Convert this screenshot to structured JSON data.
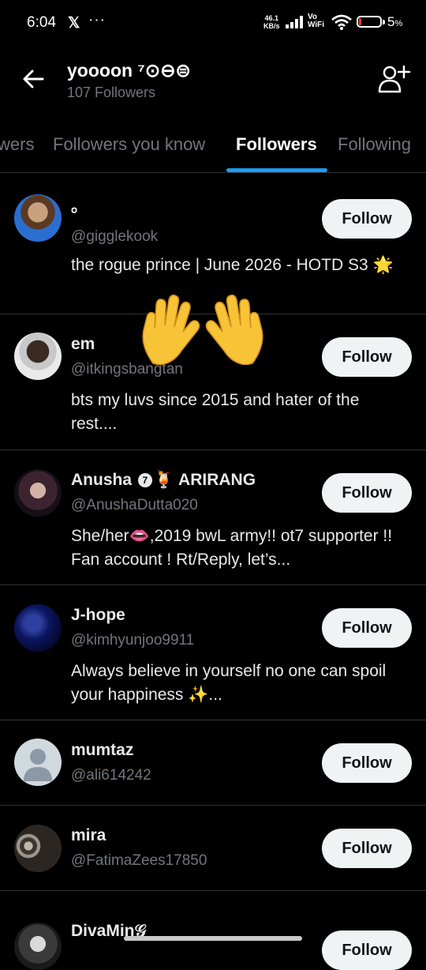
{
  "status_bar": {
    "time": "6:04",
    "x_glyph": "𝕏",
    "more": "···",
    "speed_value": "46.1",
    "speed_unit": "KB/s",
    "vo": "Vo",
    "wifi": "WiFi",
    "battery": "5",
    "battery_unit": "%",
    "battery_color": "#ff3b30"
  },
  "header": {
    "back_icon": "arrow-left-icon",
    "name": "yoooon ⁷⊙⊖⊜",
    "follower_count": "107 Followers",
    "add_icon": "add-user-icon"
  },
  "tabs": [
    "wers",
    "Followers you know",
    "Followers",
    "Following"
  ],
  "active_tab": "Followers",
  "accent_color": "#1d9bf0",
  "followers": [
    {
      "name": "。",
      "handle": "@gigglekook",
      "bio": "the rogue prince | June 2026 - HOTD S3 🌟",
      "button": "Follow"
    },
    {
      "name": "em",
      "handle": "@itkingsbangtan",
      "bio": "bts my luvs since 2015 and hater of the rest....",
      "button": "Follow"
    },
    {
      "name_prefix": "Anusha",
      "name_badge": "7",
      "name_suffix": "🍹 ARIRANG",
      "handle": "@AnushaDutta020",
      "bio": "She/her👄,2019 bwL army!! ot7 supporter !! Fan account ! Rt/Reply, let’s...",
      "button": "Follow"
    },
    {
      "name": "J-hope",
      "handle": "@kimhyunjoo9911",
      "bio": "Always believe in yourself no one can spoil your happiness ✨...",
      "button": "Follow"
    },
    {
      "name": "mumtaz",
      "handle": "@ali614242",
      "button": "Follow"
    },
    {
      "name": "mira",
      "handle": "@FatimaZees17850",
      "button": "Follow"
    },
    {
      "name": "DivaMin𝒢",
      "button": "Follow"
    }
  ]
}
